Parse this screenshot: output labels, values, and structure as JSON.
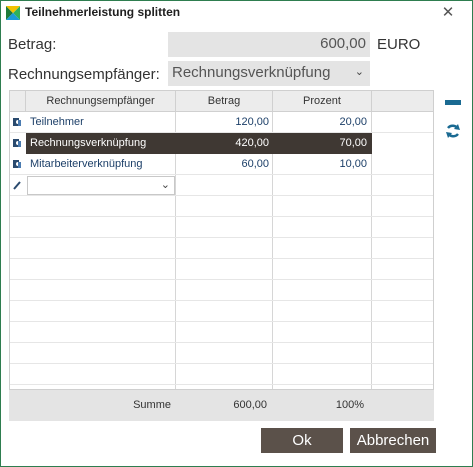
{
  "window": {
    "title": "Teilnehmerleistung splitten",
    "accent_color": "#2e7d4f"
  },
  "form": {
    "amount_label": "Betrag:",
    "amount_value": "600,00",
    "currency": "EURO",
    "recipient_label": "Rechnungsempfänger:",
    "recipient_value": "Rechnungsverknüpfung"
  },
  "grid": {
    "columns": [
      "Rechnungsempfänger",
      "Betrag",
      "Prozent"
    ],
    "rows": [
      {
        "recipient": "Teilnehmer",
        "amount": "120,00",
        "percent": "20,00",
        "selected": false
      },
      {
        "recipient": "Rechnungsverknüpfung",
        "amount": "420,00",
        "percent": "70,00",
        "selected": true
      },
      {
        "recipient": "Mitarbeiterverknüpfung",
        "amount": "60,00",
        "percent": "10,00",
        "selected": false
      }
    ],
    "selected_row_color": "#3f3833",
    "text_color": "#1c3f68"
  },
  "summary": {
    "label": "Summe",
    "amount": "600,00",
    "percent": "100%"
  },
  "buttons": {
    "ok": "Ok",
    "cancel": "Abbrechen",
    "color": "#5b514a"
  },
  "icons": {
    "row": "person-card-icon",
    "edit": "pencil-icon",
    "remove": "minus-icon",
    "refresh": "refresh-icon",
    "close": "close-icon",
    "app": "app-logo-icon"
  }
}
